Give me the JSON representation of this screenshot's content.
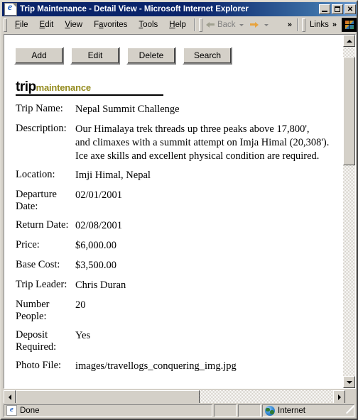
{
  "window": {
    "title": "Trip Maintenance - Detail View - Microsoft Internet Explorer",
    "icon": "ie-document-icon",
    "controls": {
      "minimize": "minimize-button",
      "maximize": "maximize-button",
      "close": "close-button",
      "close_glyph": "✕"
    }
  },
  "menubar": {
    "items": [
      {
        "label": "File",
        "accel": "F",
        "rest": "ile"
      },
      {
        "label": "Edit",
        "accel": "E",
        "rest": "dit"
      },
      {
        "label": "View",
        "accel": "V",
        "rest": "iew"
      },
      {
        "label": "Favorites",
        "pre": "F",
        "accel": "a",
        "rest": "vorites"
      },
      {
        "label": "Tools",
        "accel": "T",
        "rest": "ools"
      },
      {
        "label": "Help",
        "accel": "H",
        "rest": "elp"
      }
    ],
    "nav": {
      "back_label": "Back",
      "back_enabled": false,
      "forward_label": "",
      "overflow_chevron": "»"
    },
    "links_label": "Links",
    "links_chevron": "»",
    "brand_logo": "windows-flag-logo"
  },
  "toolbar": {
    "buttons": [
      {
        "label": "Add",
        "name": "add-button"
      },
      {
        "label": "Edit",
        "name": "edit-button"
      },
      {
        "label": "Delete",
        "name": "delete-button"
      },
      {
        "label": "Search",
        "name": "search-button"
      }
    ]
  },
  "page_heading": {
    "primary": "trip",
    "secondary": "maintenance",
    "primary_color": "#000000",
    "secondary_color": "#948b1e"
  },
  "detail": {
    "rows": [
      {
        "label": "Trip Name:",
        "value": "Nepal Summit Challenge",
        "tall": false
      },
      {
        "label": "Description:",
        "value": "Our Himalaya trek threads up three peaks above 17,800',\nand climaxes with a summit attempt on Imja Himal (20,308').\nIce axe skills and excellent physical condition are required.",
        "tall": false
      },
      {
        "label": "Location:",
        "value": "Imji Himal, Nepal",
        "tall": false
      },
      {
        "label": "Departure Date:",
        "value": "02/01/2001",
        "tall": true
      },
      {
        "label": "Return Date:",
        "value": "02/08/2001",
        "tall": false
      },
      {
        "label": "Price:",
        "value": "$6,000.00",
        "tall": false
      },
      {
        "label": "Base Cost:",
        "value": "$3,500.00",
        "tall": false
      },
      {
        "label": "Trip Leader:",
        "value": "Chris Duran",
        "tall": false
      },
      {
        "label": "Number People:",
        "value": "20",
        "tall": true
      },
      {
        "label": "Deposit Required:",
        "value": "Yes",
        "tall": true
      },
      {
        "label": "Photo File:",
        "value": "images/travellogs_conquering_img.jpg",
        "tall": false
      }
    ]
  },
  "record_nav": {
    "buttons": [
      {
        "name": "first-record-button",
        "icon": "first-record-icon"
      },
      {
        "name": "previous-record-button",
        "icon": "previous-record-icon"
      },
      {
        "name": "next-record-button",
        "icon": "next-record-icon"
      },
      {
        "name": "last-record-button",
        "icon": "last-record-icon"
      }
    ]
  },
  "statusbar": {
    "message": "Done",
    "zone": "Internet",
    "zone_icon": "globe-icon",
    "page_icon": "ie-page-icon"
  },
  "scrollbars": {
    "vertical": {
      "thumb_top_pct": 3,
      "thumb_height_pct": 33
    },
    "horizontal": {
      "thumb_left_pct": 0,
      "thumb_width_pct": 58
    }
  }
}
